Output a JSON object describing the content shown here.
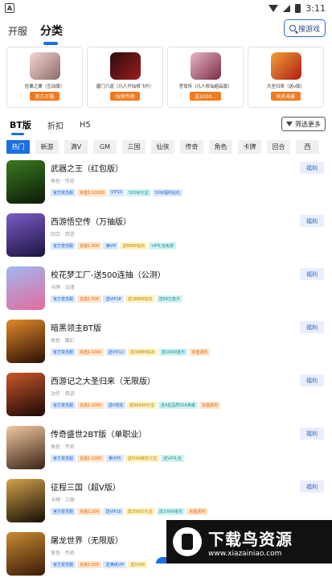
{
  "status": {
    "time": "3:11"
  },
  "nav": {
    "tab_open": "开服",
    "tab_category": "分类",
    "search_label": "搜游戏"
  },
  "featured": [
    {
      "name": "狂暴之翼（互动版）",
      "badge": "官方正服",
      "c1": "#f1d7d1",
      "c2": "#8e6a6a"
    },
    {
      "name": "唐门六道（凡人开仙修飞升）",
      "badge": "仙侠传奇",
      "c1": "#2a0c0c",
      "c2": "#9c1e1e"
    },
    {
      "name": "苍穹传（凡人修仙超品版）",
      "badge": "送1000...",
      "c1": "#e6b8c8",
      "c2": "#7a2b44"
    },
    {
      "name": "大圣归来（送v版）",
      "badge": "同名电影",
      "c1": "#f0a23a",
      "c2": "#b01c12"
    }
  ],
  "subtabs": {
    "bt": "BT版",
    "discount": "折扣",
    "h5": "H5",
    "filter": "筛选更多"
  },
  "categories": [
    "热门",
    "新游",
    "满V",
    "GM",
    "三国",
    "仙侠",
    "传奇",
    "角色",
    "卡牌",
    "回合",
    "西"
  ],
  "welfare_label": "福利",
  "games": [
    {
      "name": "武器之王（红包版）",
      "meta": "角色 · 传奇",
      "c1": "#3a7a20",
      "c2": "#0c1a08",
      "tags": [
        {
          "t": "官方变态服",
          "c": "t-blue"
        },
        {
          "t": "充值1:10000",
          "c": "t-orange"
        },
        {
          "t": "VIP10",
          "c": "t-blue"
        },
        {
          "t": "500W元宝",
          "c": "t-cyan"
        },
        {
          "t": "50W福利钻石",
          "c": "t-blue"
        }
      ]
    },
    {
      "name": "西游悟空传（万抽版）",
      "meta": "回合 · 西游",
      "c1": "#7b5cc8",
      "c2": "#1c1440",
      "tags": [
        {
          "t": "官方变态服",
          "c": "t-blue"
        },
        {
          "t": "充值1:500",
          "c": "t-orange"
        },
        {
          "t": "满VIP",
          "c": "t-blue"
        },
        {
          "t": "送8888钻石",
          "c": "t-yellow"
        },
        {
          "t": "VIP礼包免费",
          "c": "t-cyan"
        }
      ]
    },
    {
      "name": "校花梦工厂-送500连抽（公测）",
      "meta": "卡牌 · 动漫",
      "c1": "#9fb8f0",
      "c2": "#e56a9c",
      "tags": [
        {
          "t": "官方变态服",
          "c": "t-blue"
        },
        {
          "t": "充值1:500",
          "c": "t-orange"
        },
        {
          "t": "送VIP18",
          "c": "t-blue"
        },
        {
          "t": "送18888钻石",
          "c": "t-yellow"
        },
        {
          "t": "送88万金币",
          "c": "t-cyan"
        }
      ]
    },
    {
      "name": "暗黑领主BT版",
      "meta": "角色 · 魔幻",
      "c1": "#e08a2a",
      "c2": "#2a0f05",
      "tags": [
        {
          "t": "官方变态服",
          "c": "t-blue"
        },
        {
          "t": "充值1:1000",
          "c": "t-orange"
        },
        {
          "t": "送VIP12",
          "c": "t-blue"
        },
        {
          "t": "送38888钻石",
          "c": "t-yellow"
        },
        {
          "t": "送100W金币",
          "c": "t-cyan"
        },
        {
          "t": "充值返利",
          "c": "t-orange"
        }
      ]
    },
    {
      "name": "西游记之大圣归来（无限版）",
      "meta": "动作 · 西游",
      "c1": "#c9582a",
      "c2": "#1a0806",
      "tags": [
        {
          "t": "官方变态服",
          "c": "t-blue"
        },
        {
          "t": "充值1:1000",
          "c": "t-orange"
        },
        {
          "t": "送V增加",
          "c": "t-blue"
        },
        {
          "t": "送99999元宝",
          "c": "t-yellow"
        },
        {
          "t": "送4星品质SSR英雄",
          "c": "t-cyan"
        },
        {
          "t": "充值返利",
          "c": "t-orange"
        }
      ]
    },
    {
      "name": "传奇盛世2BT版（单职业）",
      "meta": "角色 · 传奇",
      "c1": "#f2c9a0",
      "c2": "#3a2418",
      "tags": [
        {
          "t": "官方变态服",
          "c": "t-blue"
        },
        {
          "t": "充值1:1000",
          "c": "t-orange"
        },
        {
          "t": "满VIP5",
          "c": "t-blue"
        },
        {
          "t": "送50W绑定元宝",
          "c": "t-yellow"
        },
        {
          "t": "送VIP礼包",
          "c": "t-cyan"
        }
      ]
    },
    {
      "name": "征程三国（超V版）",
      "meta": "卡牌 · 三国",
      "c1": "#d4a14a",
      "c2": "#140d06",
      "tags": [
        {
          "t": "官方变态服",
          "c": "t-blue"
        },
        {
          "t": "充值1:200",
          "c": "t-orange"
        },
        {
          "t": "送VIP18",
          "c": "t-blue"
        },
        {
          "t": "送20000元宝",
          "c": "t-yellow"
        },
        {
          "t": "送100W金币",
          "c": "t-cyan"
        },
        {
          "t": "充值返利",
          "c": "t-orange"
        }
      ]
    },
    {
      "name": "屠龙世界（无限版）",
      "meta": "角色 · 传奇",
      "c1": "#c88a32",
      "c2": "#3a1a08",
      "tags": [
        {
          "t": "官方变态服",
          "c": "t-blue"
        },
        {
          "t": "充值1:500",
          "c": "t-orange"
        },
        {
          "t": "送满级VIP",
          "c": "t-blue"
        },
        {
          "t": "送1000",
          "c": "t-yellow"
        }
      ]
    }
  ],
  "watermark": {
    "title": "下载鸟资源",
    "url": "www.xiazainiao.com"
  }
}
